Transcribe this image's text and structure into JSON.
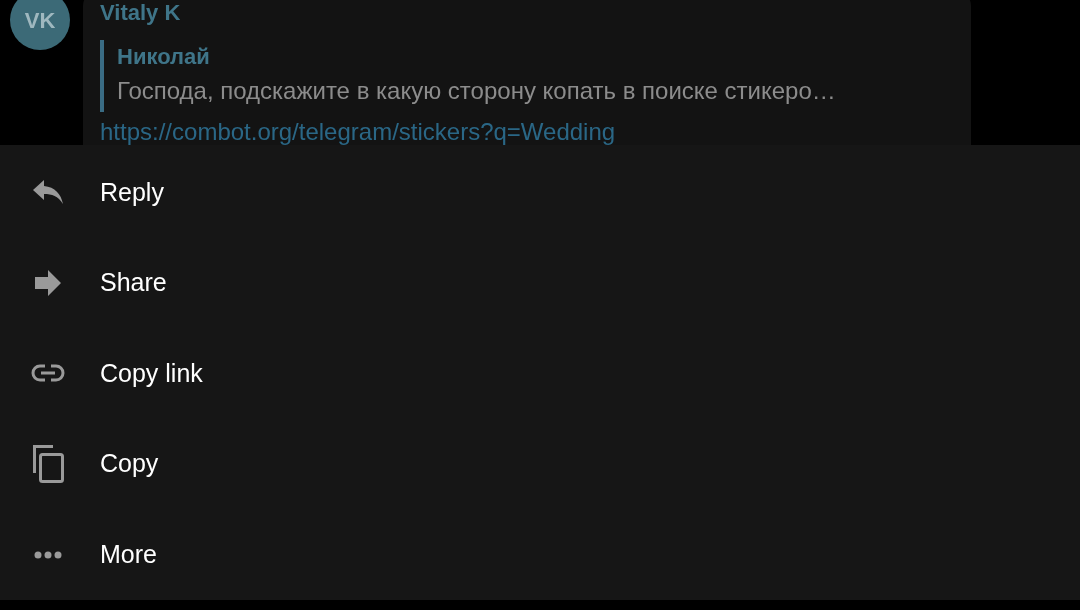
{
  "message": {
    "avatar_initials": "VK",
    "sender": "Vitaly K",
    "quote": {
      "author": "Николай",
      "text": "Господа, подскажите в какую сторону копать в поиске стикеро…"
    },
    "link": "https://combot.org/telegram/stickers?q=Wedding"
  },
  "menu": [
    {
      "kind": "reply",
      "label": "Reply"
    },
    {
      "kind": "share",
      "label": "Share"
    },
    {
      "kind": "link",
      "label": "Copy link"
    },
    {
      "kind": "copy",
      "label": "Copy"
    },
    {
      "kind": "more",
      "label": "More"
    }
  ]
}
